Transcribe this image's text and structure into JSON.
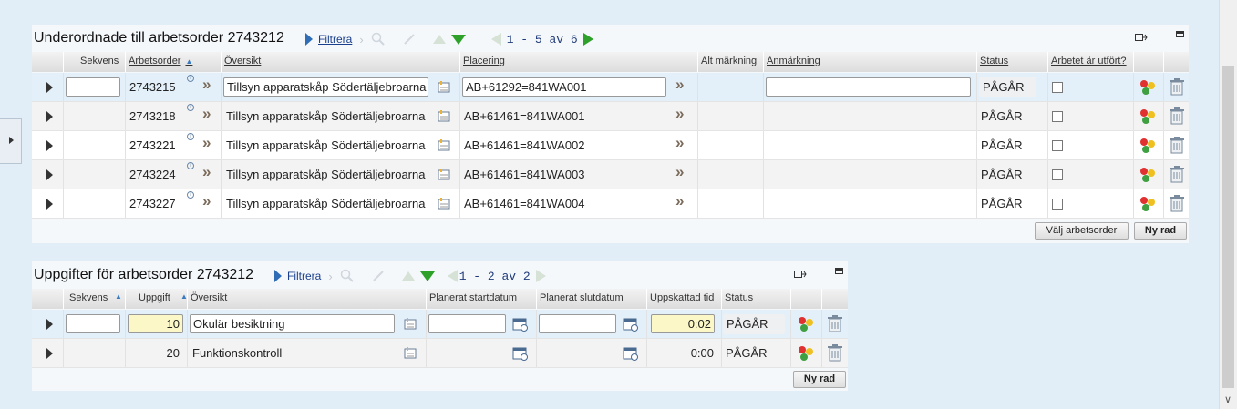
{
  "panel1": {
    "title": "Underordnade till arbetsorder 2743212",
    "filter_label": "Filtrera",
    "pagination": "1 - 5 av 6",
    "columns": [
      "Sekvens",
      "Arbetsorder",
      "Översikt",
      "Placering",
      "Alt märkning",
      "Anmärkning",
      "Status",
      "Arbetet är utfört?"
    ],
    "rows": [
      {
        "arbetsorder": "2743215",
        "oversikt": "Tillsyn apparatskåp Södertäljebroarna",
        "placering": "AB+61292=841WA001",
        "status": "PÅGÅR"
      },
      {
        "arbetsorder": "2743218",
        "oversikt": "Tillsyn apparatskåp Södertäljebroarna",
        "placering": "AB+61461=841WA001",
        "status": "PÅGÅR"
      },
      {
        "arbetsorder": "2743221",
        "oversikt": "Tillsyn apparatskåp Södertäljebroarna",
        "placering": "AB+61461=841WA002",
        "status": "PÅGÅR"
      },
      {
        "arbetsorder": "2743224",
        "oversikt": "Tillsyn apparatskåp Södertäljebroarna",
        "placering": "AB+61461=841WA003",
        "status": "PÅGÅR"
      },
      {
        "arbetsorder": "2743227",
        "oversikt": "Tillsyn apparatskåp Södertäljebroarna",
        "placering": "AB+61461=841WA004",
        "status": "PÅGÅR"
      }
    ],
    "buttons": {
      "select": "Välj arbetsorder",
      "new_row": "Ny rad"
    }
  },
  "panel2": {
    "title": "Uppgifter för arbetsorder 2743212",
    "filter_label": "Filtrera",
    "pagination": "1 - 2 av 2",
    "columns": [
      "Sekvens",
      "Uppgift",
      "Översikt",
      "Planerat startdatum",
      "Planerat slutdatum",
      "Uppskattad tid",
      "Status"
    ],
    "rows": [
      {
        "uppgift": "10",
        "oversikt": "Okulär besiktning",
        "tid": "0:02",
        "status": "PÅGÅR"
      },
      {
        "uppgift": "20",
        "oversikt": "Funktionskontroll",
        "tid": "0:00",
        "status": "PÅGÅR"
      }
    ],
    "buttons": {
      "new_row": "Ny rad"
    }
  },
  "icons": {
    "sort": "sort-asc-icon",
    "info": "info-icon",
    "detail": "details-icon",
    "calendar": "calendar-icon",
    "delete": "trash-icon",
    "route": "route-icon"
  }
}
